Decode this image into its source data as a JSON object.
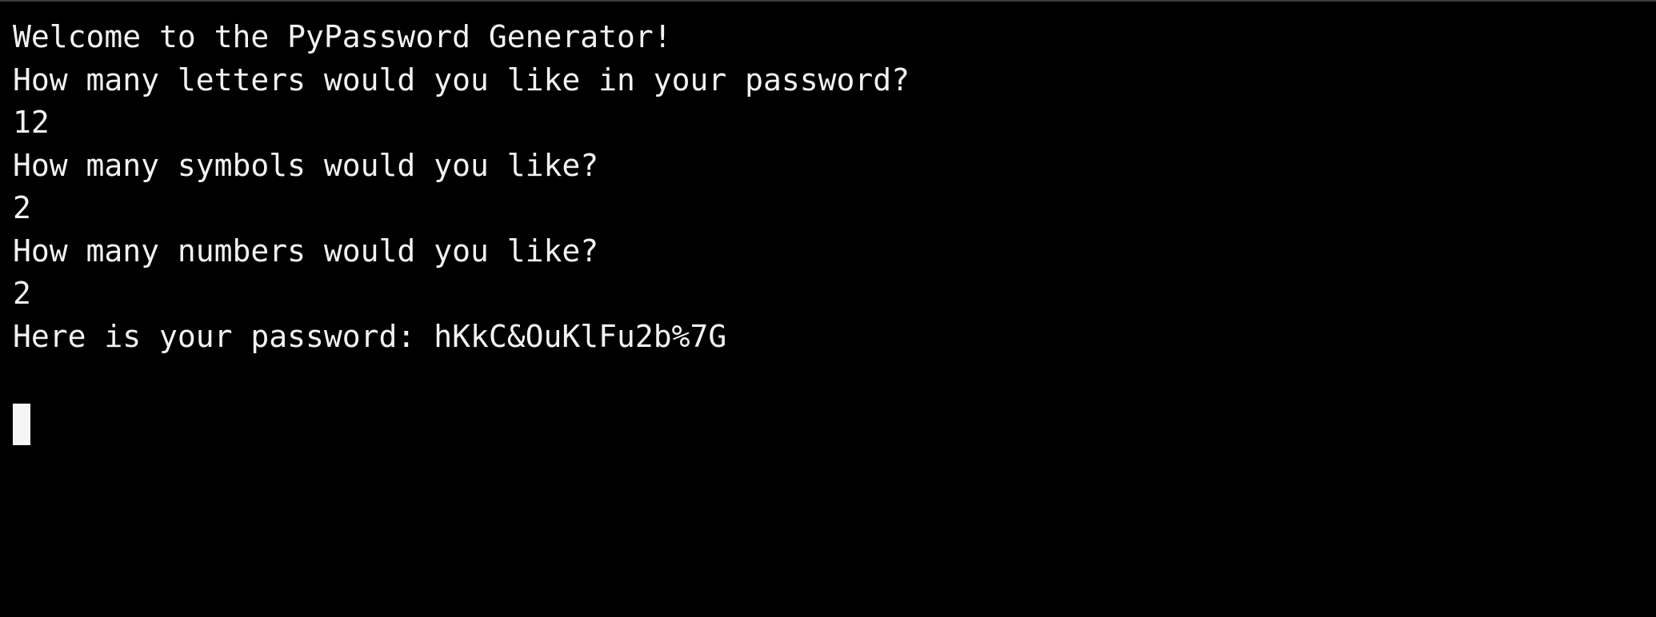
{
  "terminal": {
    "lines": [
      "Welcome to the PyPassword Generator!",
      "How many letters would you like in your password?",
      "12",
      "How many symbols would you like?",
      "2",
      "How many numbers would you like?",
      "2",
      "Here is your password: hKkC&OuKlFu2b%7G"
    ]
  },
  "colors": {
    "background": "#000000",
    "foreground": "#f2f2f2",
    "cursor": "#f5f5f5"
  }
}
